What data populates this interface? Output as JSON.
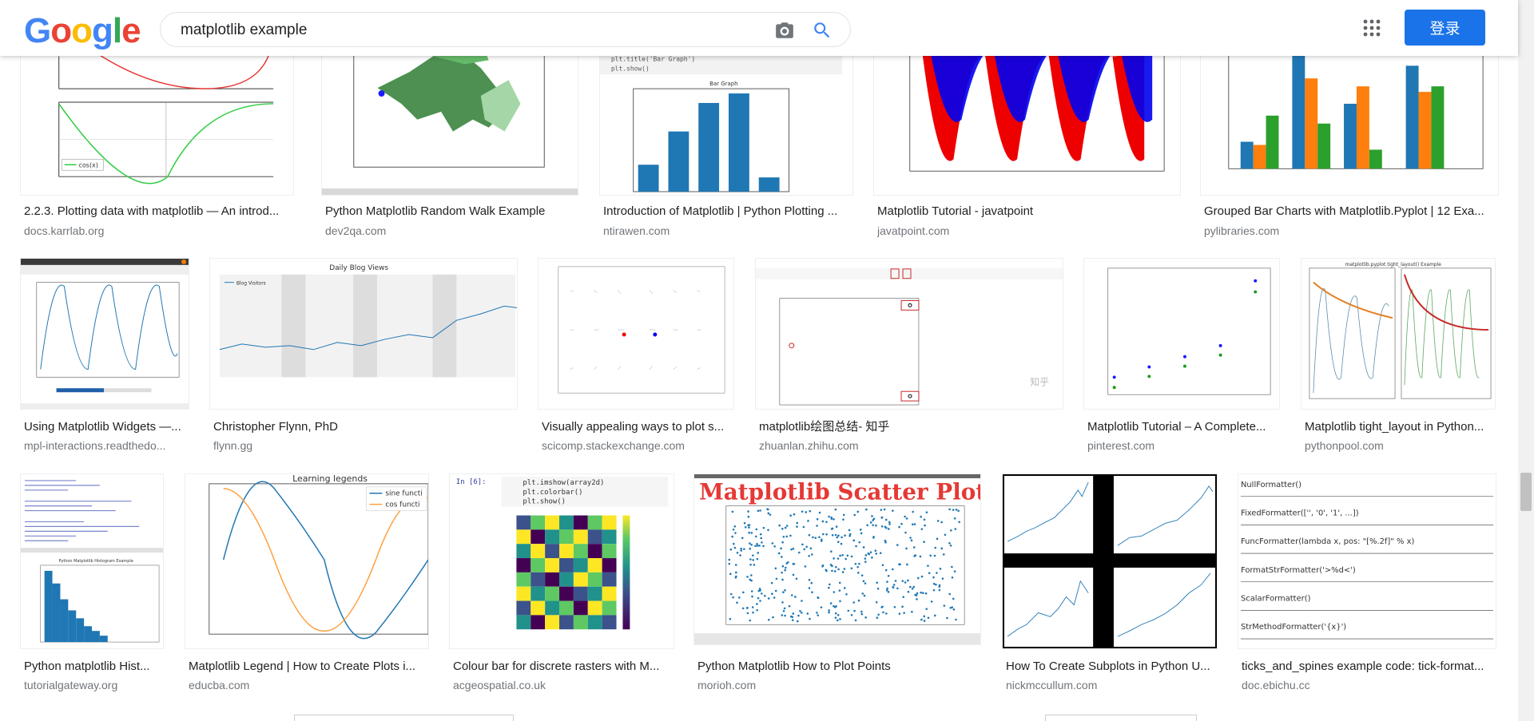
{
  "header": {
    "logo_letters": [
      "G",
      "o",
      "o",
      "g",
      "l",
      "e"
    ],
    "logo_colors": [
      "#4285F4",
      "#EA4335",
      "#FBBC05",
      "#4285F4",
      "#34A853",
      "#EA4335"
    ],
    "search_value": "matplotlib example",
    "login_label": "登录"
  },
  "icons": {
    "camera": "camera-icon",
    "search": "search-icon",
    "apps": "apps-grid-icon"
  },
  "results": [
    {
      "title": "2.2.3. Plotting data with matplotlib — An introd...",
      "source": "docs.karrlab.org"
    },
    {
      "title": "Python Matplotlib Random Walk Example",
      "source": "dev2qa.com"
    },
    {
      "title": "Introduction of Matplotlib | Python Plotting ...",
      "source": "ntirawen.com"
    },
    {
      "title": "Matplotlib Tutorial - javatpoint",
      "source": "javatpoint.com"
    },
    {
      "title": "Grouped Bar Charts with Matplotlib.Pyplot | 12 Exa...",
      "source": "pylibraries.com"
    },
    {
      "title": "Using Matplotlib Widgets —...",
      "source": "mpl-interactions.readthedo..."
    },
    {
      "title": "Christopher Flynn, PhD",
      "source": "flynn.gg"
    },
    {
      "title": "Visually appealing ways to plot s...",
      "source": "scicomp.stackexchange.com"
    },
    {
      "title": "matplotlib绘图总结- 知乎",
      "source": "zhuanlan.zhihu.com"
    },
    {
      "title": "Matplotlib Tutorial – A Complete...",
      "source": "pinterest.com"
    },
    {
      "title": "Matplotlib tight_layout in Python...",
      "source": "pythonpool.com"
    },
    {
      "title": "Python matplotlib Hist...",
      "source": "tutorialgateway.org"
    },
    {
      "title": "Matplotlib Legend | How to Create Plots i...",
      "source": "educba.com"
    },
    {
      "title": "Colour bar for discrete rasters with M...",
      "source": "acgeospatial.co.uk"
    },
    {
      "title": "Python Matplotlib How to Plot Points",
      "source": "morioh.com"
    },
    {
      "title": "How To Create Subplots in Python U...",
      "source": "nickmccullum.com"
    },
    {
      "title": "ticks_and_spines example code: tick-format...",
      "source": "doc.ebichu.cc"
    }
  ],
  "thumb_text": {
    "bar_graph_title": "Bar Graph",
    "blog_title": "Daily Blog Views",
    "blog_legend": "Blog Visitors",
    "learning_legends": "Learning legends",
    "sine_label": "sine functi",
    "cos_label": "cos functi",
    "scatter_title": "Matplotlib Scatter Plot",
    "zhihu_mark": "知乎",
    "tight_layout_title": "matplotlib.pyplot tight_layout() Example",
    "hist_title": "Python Matplotlib Histogram Example",
    "code_in": "In [6]:",
    "code_lines": [
      "plt.imshow(array2d)",
      "plt.colorbar()",
      "plt.show()"
    ],
    "bar_code_lines": [
      "plt.title('Bar Graph')",
      "plt.show()"
    ],
    "formatters": [
      "NullFormatter()",
      "FixedFormatter(['', '0', '1', ...])",
      "FuncFormatter(lambda x, pos: \"[%.2f]\" % x)",
      "FormatStrFormatter('>%d<')",
      "ScalarFormatter()",
      "StrMethodFormatter('{x}')"
    ],
    "cos_legend": "cos(x)"
  }
}
